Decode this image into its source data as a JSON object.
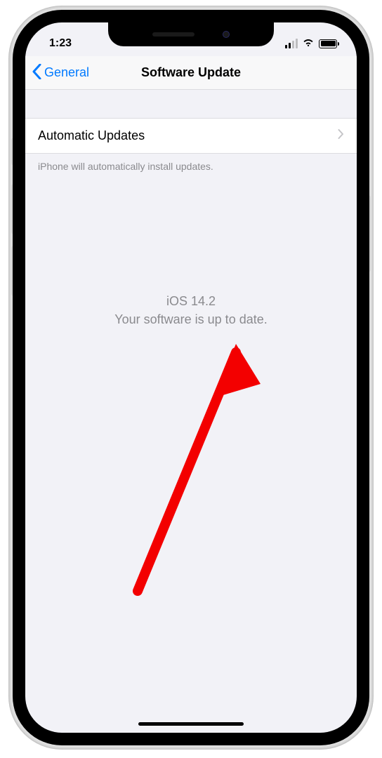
{
  "status_bar": {
    "time": "1:23"
  },
  "navbar": {
    "back_label": "General",
    "title": "Software Update"
  },
  "settings": {
    "automatic_updates_label": "Automatic Updates",
    "auto_updates_footer": "iPhone will automatically install updates."
  },
  "update_status": {
    "version": "iOS 14.2",
    "message": "Your software is up to date."
  }
}
